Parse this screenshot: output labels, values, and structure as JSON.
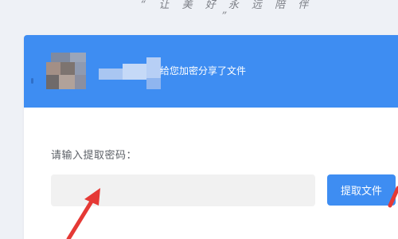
{
  "page": {
    "slogan": "“ 让 美 好 永 远 陪 伴 ”"
  },
  "share_card": {
    "header": {
      "sharer_name_obscured": true,
      "message_suffix": "给您加密分享了文件"
    },
    "password_prompt": "请输入提取密码：",
    "password_input": {
      "value": "",
      "placeholder": ""
    },
    "extract_button_label": "提取文件"
  },
  "annotations": {
    "arrow_color": "#e53935"
  },
  "colors": {
    "accent": "#3e8df2",
    "page_background": "#eef1f6",
    "input_background": "#f1f1f1"
  }
}
